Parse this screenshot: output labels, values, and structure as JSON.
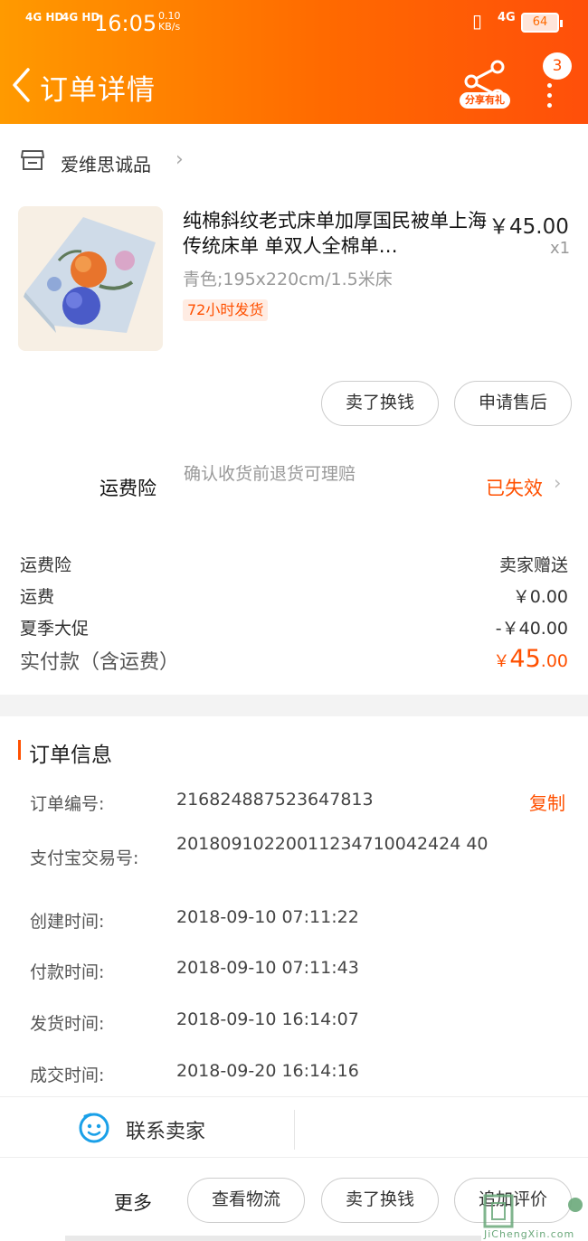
{
  "status_bar": {
    "signal1": "4G HD",
    "signal2": "4G HD",
    "time": "16:05",
    "speed_value": "0.10",
    "speed_unit": "KB/s",
    "network": "4G",
    "battery": "64"
  },
  "header": {
    "title": "订单详情",
    "share_label": "分享有礼",
    "badge_count": "3"
  },
  "shop": {
    "name": "爱维思诚品"
  },
  "product": {
    "title": "纯棉斜纹老式床单加厚国民被单上海传统床单 单双人全棉单…",
    "price": "￥45.00",
    "quantity": "x1",
    "sku": "青色;195x220cm/1.5米床",
    "shipping_tag": "72小时发货",
    "buttons": [
      "卖了换钱",
      "申请售后"
    ]
  },
  "insurance": {
    "label": "运费险",
    "description": "确认收货前退货可理赔",
    "status": "已失效"
  },
  "fees": [
    {
      "label": "运费险",
      "value": "卖家赠送"
    },
    {
      "label": "运费",
      "value": "￥0.00"
    },
    {
      "label": "夏季大促",
      "value": "-￥40.00"
    }
  ],
  "total": {
    "label": "实付款（含运费）",
    "currency": "￥",
    "integer": "45",
    "decimal": ".00"
  },
  "order_info": {
    "title": "订单信息",
    "copy_label": "复制",
    "rows": [
      {
        "label": "订单编号:",
        "value": "216824887523647813"
      },
      {
        "label": "支付宝交易号:",
        "value": "20180910220011234710042424 40"
      },
      {
        "label": "创建时间:",
        "value": "2018-09-10 07:11:22"
      },
      {
        "label": "付款时间:",
        "value": "2018-09-10 07:11:43"
      },
      {
        "label": "发货时间:",
        "value": "2018-09-10 16:14:07"
      },
      {
        "label": "成交时间:",
        "value": "2018-09-20 16:14:16"
      }
    ]
  },
  "bottom": {
    "contact_label": "联系卖家",
    "more_label": "更多",
    "actions": [
      "查看物流",
      "卖了换钱",
      "追加评价"
    ]
  },
  "watermark": {
    "text": "JiChengXin.com"
  },
  "colors": {
    "accent": "#ff5000",
    "header_start": "#ff9a00",
    "header_end": "#ff4f0a"
  }
}
